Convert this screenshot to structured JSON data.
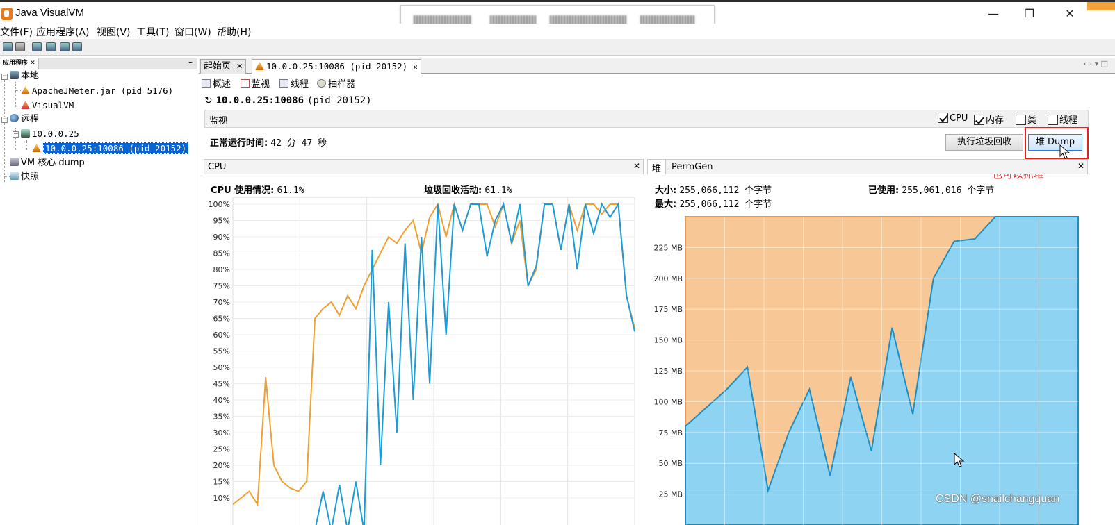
{
  "window": {
    "title": "Java VisualVM"
  },
  "menu": [
    "文件(F)",
    "应用程序(A)",
    "视图(V)",
    "工具(T)",
    "窗口(W)",
    "帮助(H)"
  ],
  "left_panel": {
    "tab_label": "应用程序",
    "tree": {
      "local": "本地",
      "local_children": [
        "ApacheJMeter.jar (pid 5176)",
        "VisualVM"
      ],
      "remote": "远程",
      "remote_host": "10.0.0.25",
      "remote_app": "10.0.0.25:10086 (pid 20152)",
      "vm_dump": "VM 核心 dump",
      "snapshots": "快照"
    }
  },
  "main_tabs": [
    {
      "label": "起始页"
    },
    {
      "label": "10.0.0.25:10086 (pid 20152)"
    }
  ],
  "sub_tabs": [
    "概述",
    "监视",
    "线程",
    "抽样器"
  ],
  "header": {
    "host": "10.0.0.25:10086",
    "pid": "(pid 20152)"
  },
  "monitor": {
    "label": "监视",
    "checkboxes": [
      {
        "label": "CPU",
        "checked": true
      },
      {
        "label": "内存",
        "checked": true
      },
      {
        "label": "类",
        "checked": false
      },
      {
        "label": "线程",
        "checked": false
      }
    ],
    "uptime_label": "正常运行时间:",
    "uptime_value": "42 分 47 秒",
    "gc_button": "执行垃圾回收",
    "heap_dump_button": "堆 Dump"
  },
  "annotation": {
    "text": "也可以抓堆",
    "color": "#e12222"
  },
  "cpu_panel": {
    "title": "CPU",
    "usage_label": "CPU 使用情况:",
    "usage_value": "61.1%",
    "gc_label": "垃圾回收活动:",
    "gc_value": "61.1%"
  },
  "heap_panel": {
    "tabs": [
      "堆",
      "PermGen"
    ],
    "size_label": "大小:",
    "size_value": "255,066,112 个字节",
    "max_label": "最大:",
    "max_value": "255,066,112 个字节",
    "used_label": "已使用:",
    "used_value": "255,061,016 个字节"
  },
  "chart_data": [
    {
      "type": "line",
      "title": "CPU",
      "ylim": [
        0,
        100
      ],
      "y_ticks": [
        "10%",
        "15%",
        "20%",
        "25%",
        "30%",
        "35%",
        "40%",
        "45%",
        "50%",
        "55%",
        "60%",
        "65%",
        "70%",
        "75%",
        "80%",
        "85%",
        "90%",
        "95%",
        "100%"
      ],
      "series": [
        {
          "name": "CPU 使用情况",
          "color": "#f0a030",
          "values": [
            8,
            10,
            12,
            8,
            47,
            20,
            15,
            13,
            12,
            15,
            65,
            68,
            70,
            66,
            72,
            68,
            75,
            80,
            85,
            90,
            88,
            92,
            95,
            85,
            96,
            100,
            90,
            100,
            92,
            100,
            100,
            100,
            93,
            100,
            88,
            95,
            75,
            80,
            100,
            100,
            86,
            100,
            92,
            100,
            100,
            97,
            100,
            100,
            72,
            62
          ]
        },
        {
          "name": "垃圾回收活动",
          "color": "#1a9cd6",
          "values": [
            0,
            0,
            0,
            0,
            0,
            0,
            0,
            0,
            0,
            0,
            0,
            12,
            0,
            14,
            0,
            15,
            0,
            86,
            20,
            70,
            30,
            88,
            40,
            90,
            45,
            100,
            60,
            100,
            92,
            100,
            100,
            84,
            95,
            100,
            88,
            100,
            75,
            81,
            100,
            100,
            86,
            100,
            80,
            100,
            91,
            100,
            96,
            100,
            72,
            61
          ]
        }
      ]
    },
    {
      "type": "area",
      "title": "堆",
      "ylim": [
        0,
        250
      ],
      "y_unit": "MB",
      "y_ticks": [
        "25 MB",
        "50 MB",
        "75 MB",
        "100 MB",
        "125 MB",
        "150 MB",
        "175 MB",
        "200 MB",
        "225 MB"
      ],
      "series": [
        {
          "name": "大小",
          "color": "#f7c896",
          "values": [
            250,
            250,
            250,
            250,
            250,
            250,
            250,
            250,
            250,
            250,
            250,
            250,
            250,
            250,
            250,
            250,
            250,
            250,
            250,
            250
          ]
        },
        {
          "name": "已使用",
          "color": "#8fd3f2",
          "values": [
            80,
            95,
            110,
            128,
            28,
            75,
            110,
            40,
            120,
            60,
            160,
            90,
            200,
            230,
            232,
            250,
            250,
            250,
            250,
            250
          ]
        }
      ]
    }
  ],
  "watermark": "CSDN @snailchangquan"
}
